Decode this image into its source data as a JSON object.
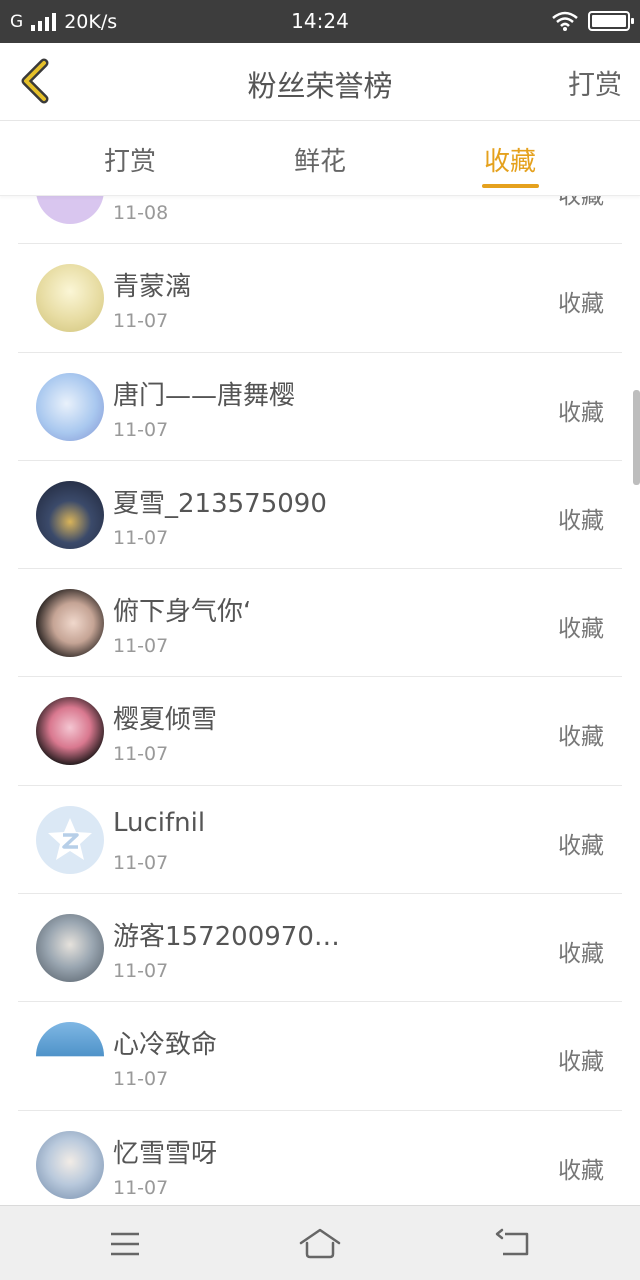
{
  "status_bar": {
    "network": "G",
    "speed": "20K/s",
    "time": "14:24",
    "icons": [
      "signal-icon",
      "wifi-icon",
      "battery-icon"
    ]
  },
  "header": {
    "title": "粉丝荣誉榜",
    "action": "打赏",
    "back_icon": "chevron-left-icon",
    "accent_color": "#e5a11d"
  },
  "tabs": [
    {
      "label": "打赏",
      "active": false
    },
    {
      "label": "鲜花",
      "active": false
    },
    {
      "label": "收藏",
      "active": true
    }
  ],
  "list": [
    {
      "name": "",
      "date": "11-08",
      "type": "收藏",
      "avatar_color": "#d9c6ef"
    },
    {
      "name": "青蒙漓",
      "date": "11-07",
      "type": "收藏",
      "avatar_color": "#efe7b8"
    },
    {
      "name": "唐门——唐舞樱",
      "date": "11-07",
      "type": "收藏",
      "avatar_color": "#a9c8ef"
    },
    {
      "name": "夏雪_213575090",
      "date": "11-07",
      "type": "收藏",
      "avatar_color": "#2b3550"
    },
    {
      "name": "俯下身气你‘",
      "date": "11-07",
      "type": "收藏",
      "avatar_color": "#5a4a46"
    },
    {
      "name": "樱夏倾雪",
      "date": "11-07",
      "type": "收藏",
      "avatar_color": "#c0607a"
    },
    {
      "name": "Lucifnil",
      "date": "11-07",
      "type": "收藏",
      "avatar_color": "#dbe8f5"
    },
    {
      "name": "游客157200970…",
      "date": "11-07",
      "type": "收藏",
      "avatar_color": "#7a8a96"
    },
    {
      "name": "心冷致命",
      "date": "11-07",
      "type": "收藏",
      "avatar_color": "#4f93c9"
    },
    {
      "name": "忆雪雪呀",
      "date": "11-07",
      "type": "收藏",
      "avatar_color": "#b9c9dc"
    }
  ],
  "nav_bar": {
    "icons": [
      "menu-icon",
      "home-icon",
      "back-icon"
    ]
  }
}
